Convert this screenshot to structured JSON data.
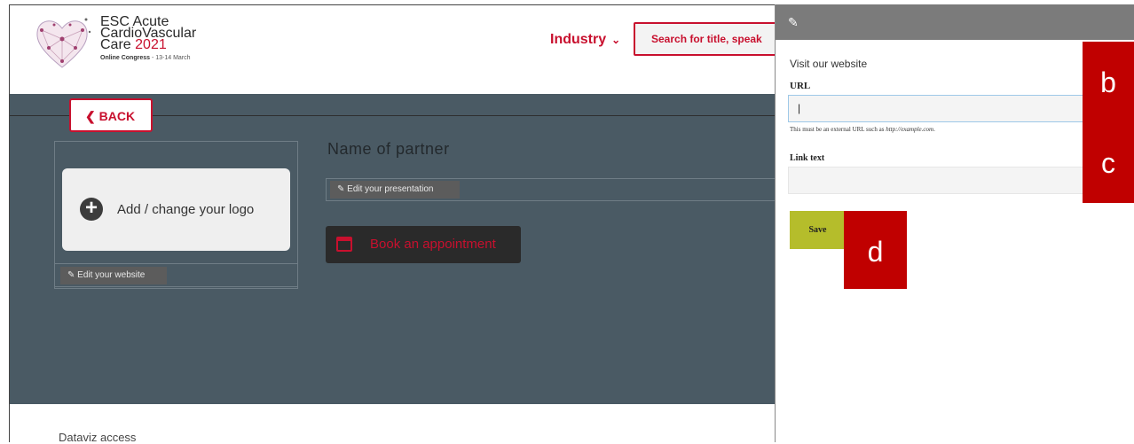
{
  "header": {
    "logo_line1": "ESC Acute",
    "logo_line2": "CardioVascular",
    "logo_line3": "Care",
    "logo_year": "2021",
    "logo_subtitle_bold": "Online Congress",
    "logo_subtitle_dates": " - 13-14 March",
    "industry_label": "Industry",
    "industry_chevron": "⌄",
    "search_placeholder": "Search for title, speak"
  },
  "main": {
    "back_label": "BACK",
    "logo_button_label": "Add / change your logo",
    "edit_website_label": "Edit your website",
    "partner_name": "Name of partner",
    "edit_presentation_label": "Edit your presentation",
    "book_label": "Book an appointment"
  },
  "footer": {
    "dataviz_label": "Dataviz access"
  },
  "panel": {
    "title": "Visit our website",
    "url_label": "URL",
    "url_value": "|",
    "url_help_prefix": "This must be an external URL such as ",
    "url_help_example": "http://example.com",
    "url_help_suffix": ".",
    "link_text_label": "Link text",
    "link_text_value": "",
    "save_label": "Save"
  },
  "annotations": {
    "b": "b",
    "c": "c",
    "d": "d"
  },
  "colors": {
    "brand_red": "#c8102e",
    "annotation_red": "#c00000",
    "main_bg": "#4a5a64",
    "save_bg": "#b5bd2b",
    "panel_bar": "#7b7b7b"
  },
  "icons": [
    "heart-network-logo-icon",
    "chevron-down-icon",
    "chevron-left-icon",
    "plus-circle-icon",
    "pencil-icon",
    "calendar-icon"
  ]
}
